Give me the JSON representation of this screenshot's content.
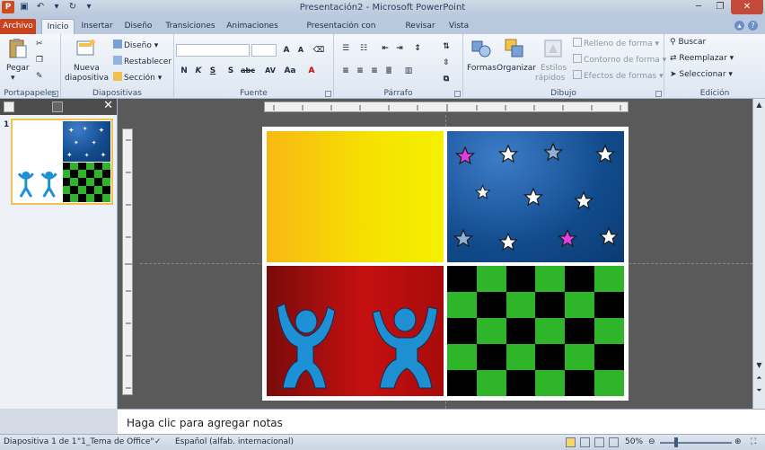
{
  "window": {
    "title": "Presentación2 - Microsoft PowerPoint"
  },
  "tabs": [
    "Archivo",
    "Inicio",
    "Insertar",
    "Diseño",
    "Transiciones",
    "Animaciones",
    "Presentación con diapositivas",
    "Revisar",
    "Vista"
  ],
  "ribbon": {
    "portapapeles": {
      "label": "Portapapeles",
      "pegar": "Pegar"
    },
    "diapositivas": {
      "label": "Diapositivas",
      "nueva": "Nueva",
      "nueva2": "diapositiva",
      "diseno": "Diseño",
      "restablecer": "Restablecer",
      "seccion": "Sección"
    },
    "fuente": {
      "label": "Fuente",
      "bold": "N",
      "italic": "K",
      "underline": "S",
      "strike": "S",
      "shadow": "abc",
      "spacing": "AV",
      "case": "Aa",
      "grow": "A",
      "shrink": "A",
      "color": "A"
    },
    "parrafo": {
      "label": "Párrafo"
    },
    "dibujo": {
      "label": "Dibujo",
      "formas": "Formas",
      "organizar": "Organizar",
      "estilos": "Estilos",
      "estilos2": "rápidos",
      "relleno": "Relleno de forma",
      "contorno": "Contorno de forma",
      "efectos": "Efectos de formas"
    },
    "edicion": {
      "label": "Edición",
      "buscar": "Buscar",
      "reemplazar": "Reemplazar",
      "seleccionar": "Seleccionar"
    }
  },
  "slides_pane": {
    "slide_number": "1"
  },
  "notes": {
    "placeholder": "Haga clic para agregar notas"
  },
  "status": {
    "slide_info": "Diapositiva 1 de 1",
    "theme": "\"1_Tema de Office\"",
    "language": "Español (alfab. internacional)",
    "zoom": "50%",
    "zoom_level": 0.5
  },
  "colors": {
    "file_tab": "#c9431f",
    "stars": "#ffffff",
    "star_accent": "#e040e0",
    "star_alt": "#8fb0d8",
    "figures": "#1e90d6",
    "checker_green": "#2fb52a"
  }
}
